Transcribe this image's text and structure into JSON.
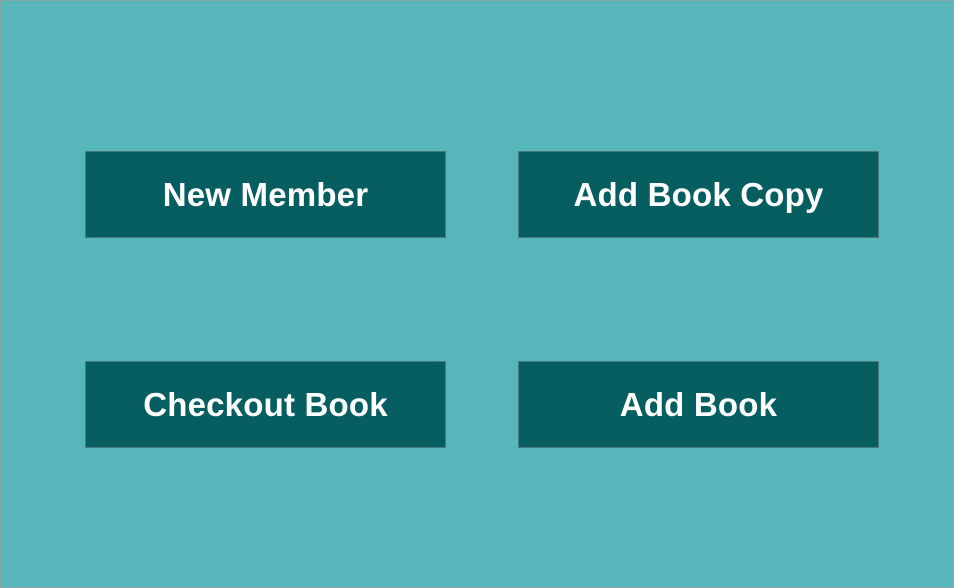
{
  "main": {
    "buttons": {
      "new_member": "New Member",
      "add_book_copy": "Add Book Copy",
      "checkout_book": "Checkout Book",
      "add_book": "Add Book"
    }
  },
  "colors": {
    "background": "#56b6ba",
    "button_background": "#075e61",
    "button_text": "#ffffff"
  }
}
